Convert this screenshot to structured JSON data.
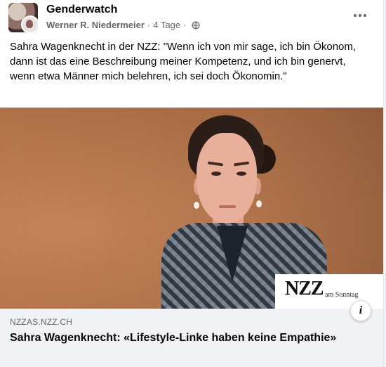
{
  "post": {
    "group_name": "Genderwatch",
    "author": "Werner R. Niedermeier",
    "separator": "·",
    "time": "4 Tage",
    "separator2": "·",
    "privacy_icon": "globe-icon",
    "more_icon": "more-horizontal-icon",
    "text": "Sahra Wagenknecht in der NZZ: \"Wenn ich von mir sage, ich bin Ökonom, dann ist das eine Beschreibung meiner Kompetenz, und ich bin genervt, wenn etwa Männer mich belehren, ich sei doch Ökonomin.\""
  },
  "image": {
    "logo_text": "NZZ",
    "logo_subtitle": "am Sonntag"
  },
  "link_preview": {
    "domain": "NZZAS.NZZ.CH",
    "headline": "Sahra Wagenknecht: «Lifestyle-Linke haben keine Empathie»",
    "info_icon": "info-icon"
  },
  "colors": {
    "text_primary": "#050505",
    "text_secondary": "#65676b",
    "preview_bg": "#f0f2f5"
  }
}
